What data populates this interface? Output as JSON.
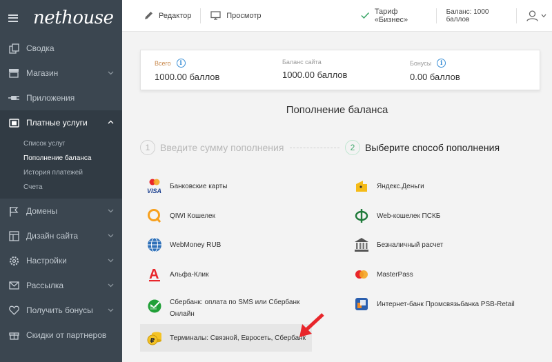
{
  "brand": {
    "logo": "nethouse"
  },
  "sidebar": {
    "items": [
      {
        "label": "Сводка",
        "icon": "copy-icon"
      },
      {
        "label": "Магазин",
        "icon": "store-icon"
      },
      {
        "label": "Приложения",
        "icon": "plug-icon"
      },
      {
        "label": "Платные услуги",
        "icon": "wallet-icon"
      },
      {
        "label": "Домены",
        "icon": "flag-icon"
      },
      {
        "label": "Дизайн сайта",
        "icon": "layout-icon"
      },
      {
        "label": "Настройки",
        "icon": "gear-icon"
      },
      {
        "label": "Рассылка",
        "icon": "mail-icon"
      },
      {
        "label": "Получить бонусы",
        "icon": "heart-icon"
      },
      {
        "label": "Скидки от партнеров",
        "icon": "gift-icon"
      }
    ],
    "submenu": [
      "Список услуг",
      "Пополнение баланса",
      "История платежей",
      "Счета"
    ]
  },
  "topbar": {
    "editor": "Редактор",
    "preview": "Просмотр",
    "tariff": "Тариф «Бизнес»",
    "balance": "Баланс: 1000 баллов"
  },
  "summary": {
    "total_label": "Всего",
    "total_value": "1000.00 баллов",
    "site_label": "Баланс сайта",
    "site_value": "1000.00 баллов",
    "bonus_label": "Бонусы",
    "bonus_value": "0.00 баллов"
  },
  "section_title": "Пополнение баланса",
  "steps": {
    "step1_num": "1",
    "step1_label": "Введите сумму пополнения",
    "step2_num": "2",
    "step2_label": "Выберите способ пополнения"
  },
  "payments": {
    "cards": "Банковские карты",
    "qiwi": "QIWI Кошелек",
    "webmoney": "WebMoney RUB",
    "alfa": "Альфа-Клик",
    "sber_line1": "Сбербанк: оплата по SMS или Сбербанк",
    "sber_line2": "Онлайн",
    "terminals": "Терминалы: Связной, Евросеть, Сбербанк",
    "yandex": "Яндекс.Деньги",
    "psbk": "Web-кошелек ПСКБ",
    "cashless": "Безналичный расчет",
    "masterpass": "MasterPass",
    "psb": "Интернет-банк Промсвязьбанка PSB-Retail",
    "visa_text": "VISA",
    "alfa_text": "А",
    "ruble_text": "₽"
  },
  "colors": {
    "sidebar": "#3b4650",
    "accent_green": "#3fa86b",
    "info_blue": "#3a8fd6",
    "arrow_red": "#e8262b"
  }
}
